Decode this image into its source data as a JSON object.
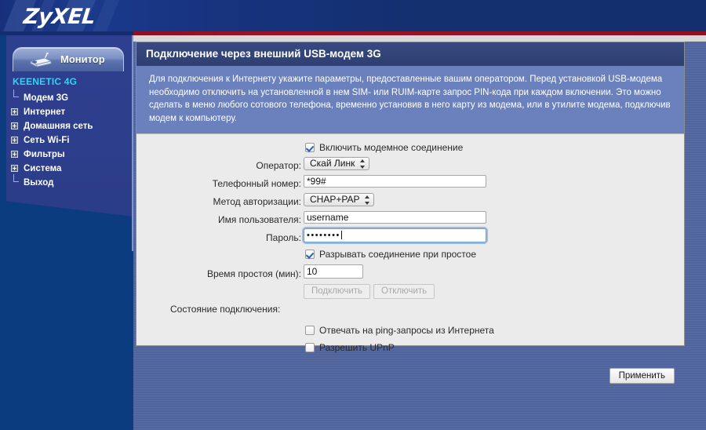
{
  "brand": {
    "logo_text": "ZyXEL"
  },
  "sidebar": {
    "monitor_tab": {
      "label": "Монитор",
      "icon": "router-icon"
    },
    "device_title": "KEENETIC 4G",
    "items": [
      {
        "label": "Модем 3G",
        "type": "leaf"
      },
      {
        "label": "Интернет",
        "type": "expandable"
      },
      {
        "label": "Домашняя сеть",
        "type": "expandable"
      },
      {
        "label": "Сеть Wi-Fi",
        "type": "expandable"
      },
      {
        "label": "Фильтры",
        "type": "expandable"
      },
      {
        "label": "Система",
        "type": "expandable"
      },
      {
        "label": "Выход",
        "type": "leaf"
      }
    ]
  },
  "panel": {
    "title": "Подключение через внешний USB-модем 3G",
    "info_text": "Для подключения к Интернету укажите параметры, предоставленные вашим оператором. Перед установкой USB-модема необходимо отключить на установленной в нем SIM- или RUIM-карте запрос PIN-кода при каждом включении. Это можно сделать в меню любого сотового телефона, временно установив в него карту из модема, или в утилите модема, подключив модем к компьютеру."
  },
  "form": {
    "enable_modem": {
      "label": "Включить модемное соединение",
      "checked": true
    },
    "operator": {
      "label": "Оператор:",
      "value": "Скай Линк"
    },
    "phone": {
      "label": "Телефонный номер:",
      "value": "*99#"
    },
    "auth_method": {
      "label": "Метод авторизации:",
      "value": "CHAP+PAP"
    },
    "username": {
      "label": "Имя пользователя:",
      "value": "username"
    },
    "password": {
      "label": "Пароль:",
      "value": "••••••••"
    },
    "disconnect_idle": {
      "label": "Разрывать соединение при простое",
      "checked": true
    },
    "idle_time": {
      "label": "Время простоя (мин):",
      "value": "10"
    },
    "connect_button": {
      "label": "Подключить",
      "disabled": true
    },
    "disconnect_button": {
      "label": "Отключить",
      "disabled": true
    },
    "connection_state": {
      "label": "Состояние подключения:",
      "value": ""
    },
    "ping_reply": {
      "label": "Отвечать на ping-запросы из Интернета",
      "checked": false
    },
    "upnp": {
      "label": "Разрешить UPnP",
      "checked": false
    },
    "apply_button": {
      "label": "Применить"
    }
  },
  "colors": {
    "brand_blue": "#142f6e",
    "accent_cyan": "#31d2f2",
    "red_stripe": "#9b1426",
    "panel_title": "#2e3f72",
    "info_panel": "#6b81bd"
  }
}
